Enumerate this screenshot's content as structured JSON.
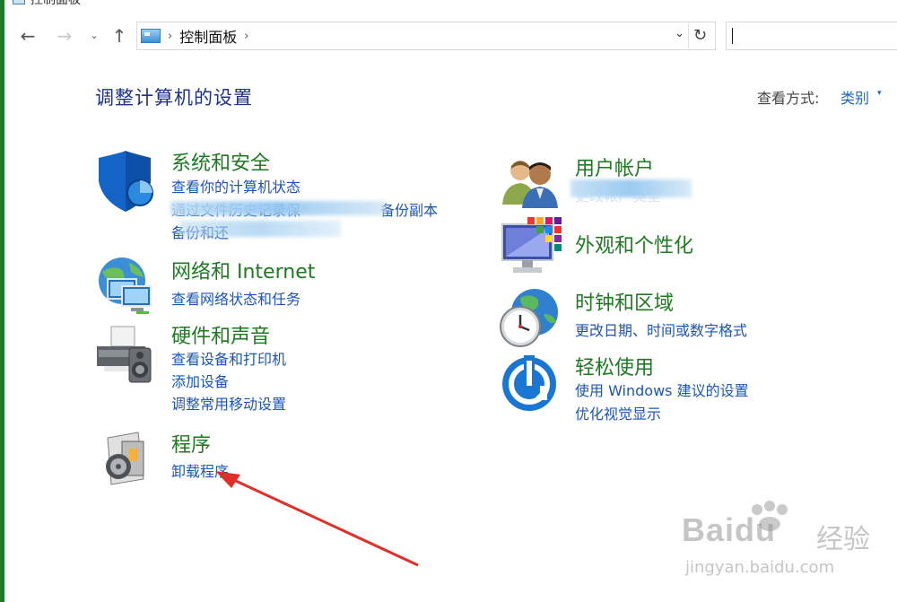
{
  "window": {
    "title": "控制面板"
  },
  "nav": {
    "back": "←",
    "forward": "→",
    "recent": "⌄",
    "up": "↑",
    "breadcrumb": "控制面板",
    "separator": "›",
    "dropdown": "⌄",
    "refresh": "↻",
    "search_value": ""
  },
  "header": {
    "title": "调整计算机的设置",
    "view_label": "查看方式:",
    "view_value": "类别",
    "view_arrow": "▾"
  },
  "categories": {
    "system": {
      "title": "系统和安全",
      "links": [
        "查看你的计算机状态",
        "通过文件历史记录保",
        "备份副本",
        "备份和还"
      ]
    },
    "user": {
      "title": "用户帐户",
      "links": [
        "更改帐户类型"
      ]
    },
    "network": {
      "title": "网络和 Internet",
      "links": [
        "查看网络状态和任务"
      ]
    },
    "appearance": {
      "title": "外观和个性化",
      "links": []
    },
    "hardware": {
      "title": "硬件和声音",
      "links": [
        "查看设备和打印机",
        "添加设备",
        "调整常用移动设置"
      ]
    },
    "clock": {
      "title": "时钟和区域",
      "links": [
        "更改日期、时间或数字格式"
      ]
    },
    "ease": {
      "title": "轻松使用",
      "links": [
        "使用 Windows 建议的设置",
        "优化视觉显示"
      ]
    },
    "programs": {
      "title": "程序",
      "links": [
        "卸载程序"
      ]
    }
  },
  "watermark": {
    "brand": "Baidu",
    "brand_cn": "经验",
    "url": "jingyan.baidu.com"
  },
  "colors": {
    "title_green": "#1e7a21",
    "link_blue": "#1b55b8",
    "header_blue": "#1e3287",
    "annotation_red": "#e0302a"
  }
}
